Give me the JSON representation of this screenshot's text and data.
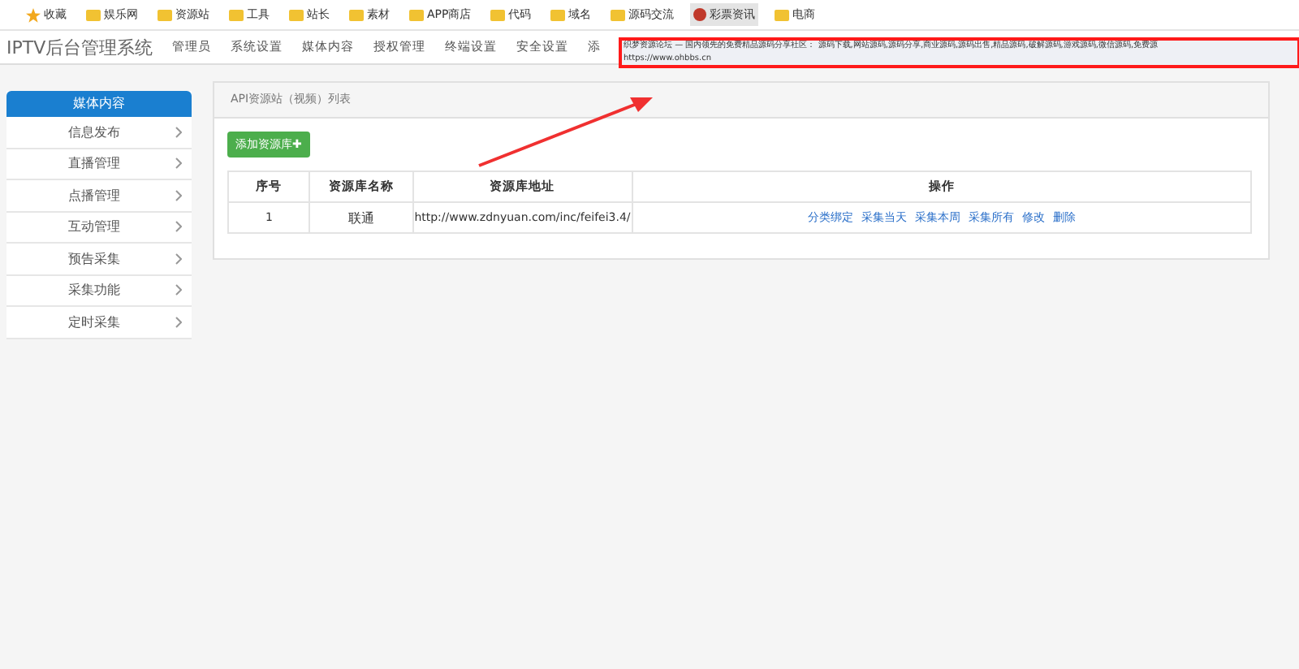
{
  "bookmarks": [
    {
      "label": "收藏",
      "kind": "star"
    },
    {
      "label": "娱乐网",
      "kind": "folder"
    },
    {
      "label": "资源站",
      "kind": "folder"
    },
    {
      "label": "工具",
      "kind": "folder"
    },
    {
      "label": "站长",
      "kind": "folder"
    },
    {
      "label": "素材",
      "kind": "folder"
    },
    {
      "label": "APP商店",
      "kind": "folder"
    },
    {
      "label": "代码",
      "kind": "folder"
    },
    {
      "label": "域名",
      "kind": "folder"
    },
    {
      "label": "源码交流",
      "kind": "folder"
    },
    {
      "label": "彩票资讯",
      "kind": "site"
    },
    {
      "label": "电商",
      "kind": "folder"
    }
  ],
  "app_title": "IPTV后台管理系统",
  "nav": [
    "管理员",
    "系统设置",
    "媒体内容",
    "授权管理",
    "终端设置",
    "安全设置",
    "添"
  ],
  "tooltip": {
    "text": "织梦资源论坛 — 国内领先的免费精品源码分享社区： 源码下载,网站源码,源码分享,商业源码,源码出售,精品源码,破解源码,游戏源码,微信源码,免费源",
    "url": "https://www.ohbbs.cn"
  },
  "sidebar": {
    "title": "媒体内容",
    "items": [
      "信息发布",
      "直播管理",
      "点播管理",
      "互动管理",
      "预告采集",
      "采集功能",
      "定时采集"
    ]
  },
  "panel": {
    "title": "API资源站（视频）列表",
    "add_button": "添加资源库✚",
    "table": {
      "columns": [
        "序号",
        "资源库名称",
        "资源库地址",
        "操作"
      ],
      "rows": [
        {
          "index": "1",
          "name": "联通",
          "url": "http://www.zdnyuan.com/inc/feifei3.4/",
          "actions": [
            "分类绑定",
            "采集当天",
            "采集本周",
            "采集所有",
            "修改",
            "删除"
          ]
        }
      ]
    }
  }
}
